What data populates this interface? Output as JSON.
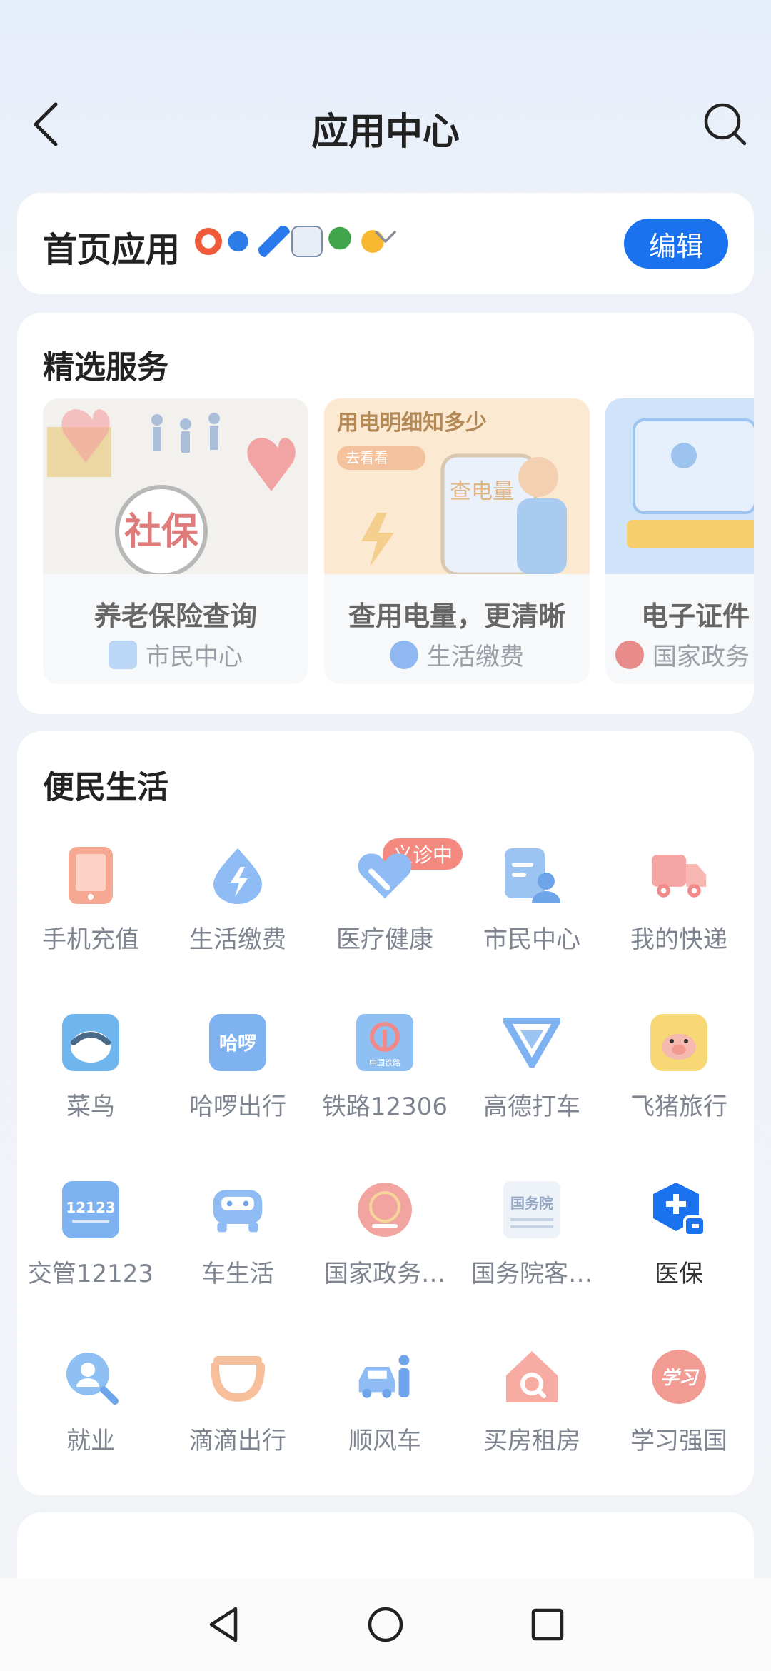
{
  "header": {
    "title": "应用中心"
  },
  "home_apps": {
    "label": "首页应用",
    "edit_label": "编辑"
  },
  "featured": {
    "title": "精选服务",
    "items": [
      {
        "title": "养老保险查询",
        "source": "市民中心",
        "image_text": "社保"
      },
      {
        "title": "查用电量，更清晰",
        "source": "生活缴费",
        "image_text": "用电明细知多少",
        "image_sub": "去看看",
        "image_phone": "查电量"
      },
      {
        "title": "电子证件",
        "source": "国家政务"
      }
    ]
  },
  "convenience": {
    "title": "便民生活",
    "badge": "义诊中",
    "items": [
      {
        "label": "手机充值",
        "icon": "phone-icon"
      },
      {
        "label": "生活缴费",
        "icon": "bolt-drop-icon"
      },
      {
        "label": "医疗健康",
        "icon": "heart-icon"
      },
      {
        "label": "市民中心",
        "icon": "citizen-icon"
      },
      {
        "label": "我的快递",
        "icon": "truck-icon"
      },
      {
        "label": "菜鸟",
        "icon": "cainiao-icon"
      },
      {
        "label": "哈啰出行",
        "icon": "hellobike-icon",
        "icon_text": "哈啰"
      },
      {
        "label": "铁路12306",
        "icon": "railway-icon",
        "icon_text": "中国铁路"
      },
      {
        "label": "高德打车",
        "icon": "amap-icon"
      },
      {
        "label": "飞猪旅行",
        "icon": "fliggy-icon"
      },
      {
        "label": "交管12123",
        "icon": "traffic-icon",
        "icon_text": "12123"
      },
      {
        "label": "车生活",
        "icon": "car-icon"
      },
      {
        "label": "国家政务…",
        "icon": "gov-service-icon"
      },
      {
        "label": "国务院客…",
        "icon": "state-council-icon",
        "icon_text": "国务院"
      },
      {
        "label": "医保",
        "icon": "medical-insurance-icon"
      },
      {
        "label": "就业",
        "icon": "employment-icon"
      },
      {
        "label": "滴滴出行",
        "icon": "didi-icon"
      },
      {
        "label": "顺风车",
        "icon": "carpool-icon"
      },
      {
        "label": "买房租房",
        "icon": "house-icon"
      },
      {
        "label": "学习强国",
        "icon": "xuexi-icon",
        "icon_text": "学习"
      }
    ]
  },
  "colors": {
    "accent": "#1a72ee",
    "badge": "#f48a7f"
  }
}
